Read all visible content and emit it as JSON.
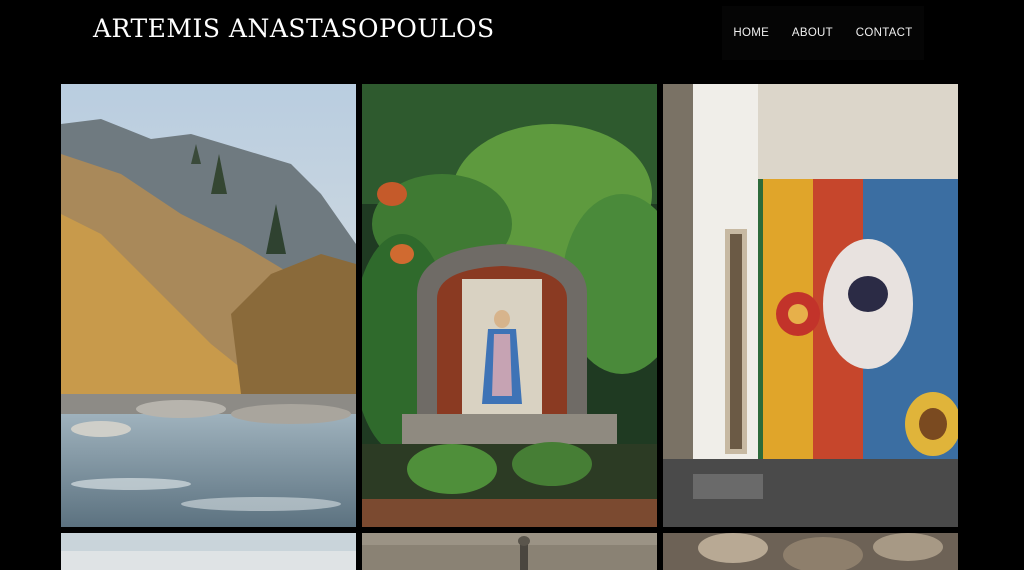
{
  "header": {
    "site_title": "ARTEMIS ANASTASOPOULOS",
    "nav": [
      {
        "label": "HOME"
      },
      {
        "label": "ABOUT"
      },
      {
        "label": "CONTACT"
      }
    ]
  },
  "gallery": {
    "photos": [
      {
        "name": "mountain-river-photo"
      },
      {
        "name": "madonna-shrine-photo"
      },
      {
        "name": "street-mural-photo"
      },
      {
        "name": "sky-photo"
      },
      {
        "name": "stone-figure-photo"
      },
      {
        "name": "rocks-photo"
      }
    ]
  },
  "colors": {
    "background": "#000000",
    "text": "#ffffff"
  }
}
